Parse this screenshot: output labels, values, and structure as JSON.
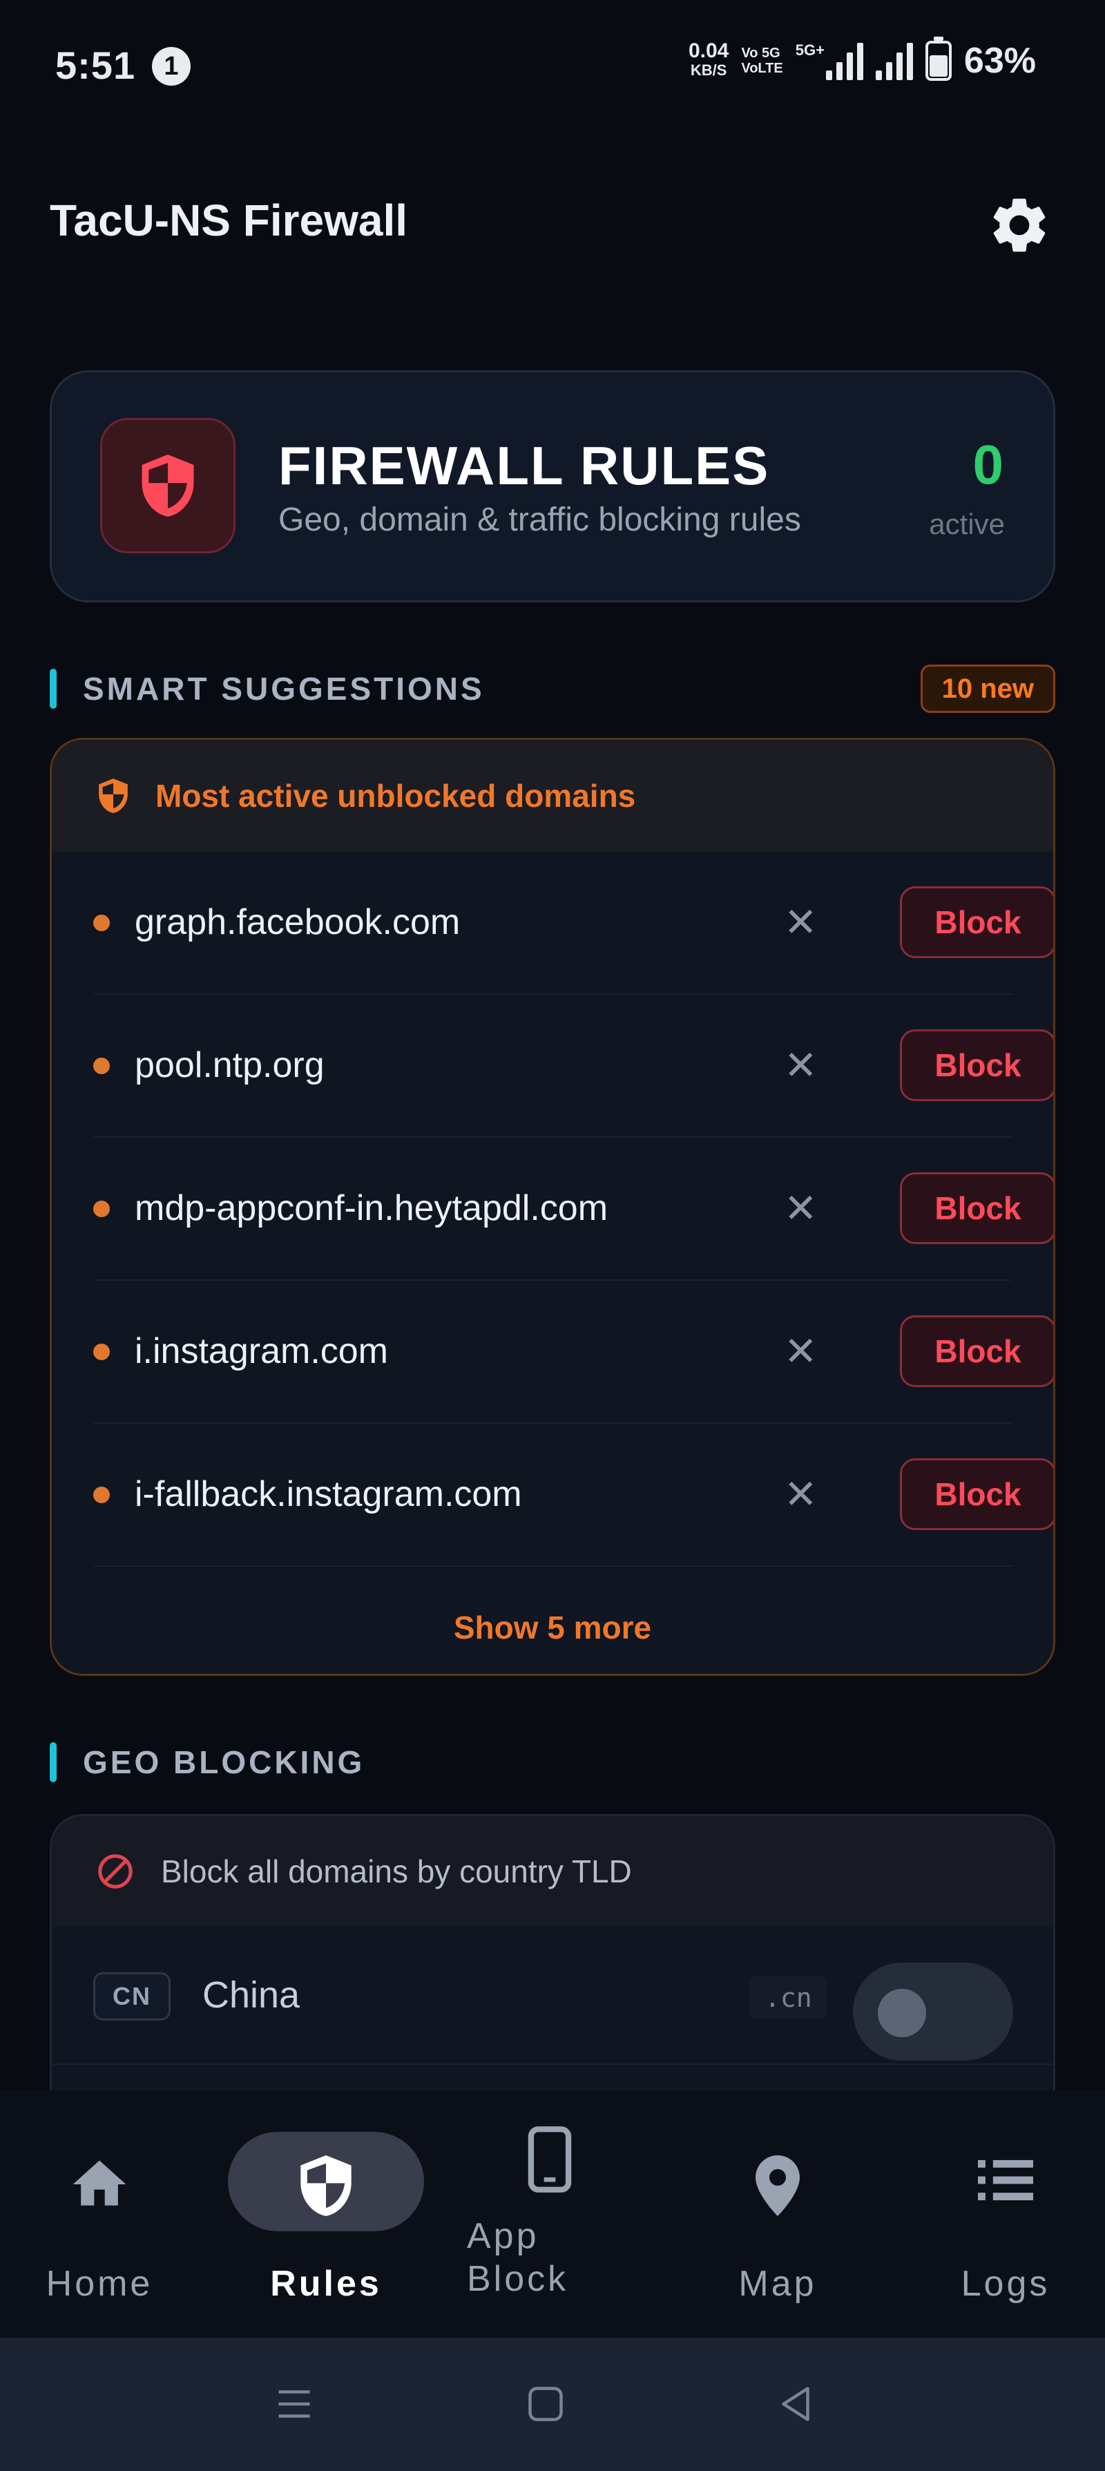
{
  "status_bar": {
    "time": "5:51",
    "notification_count": "1",
    "net_speed": "0.04",
    "net_unit": "KB/S",
    "volte_top": "Vo 5G",
    "volte_bottom": "VoLTE",
    "network": "5G+",
    "battery": "63%"
  },
  "app_bar": {
    "title": "TacU-NS Firewall",
    "settings_icon": "gear-icon"
  },
  "hero": {
    "title": "FIREWALL RULES",
    "subtitle": "Geo, domain & traffic blocking rules",
    "count": "0",
    "count_label": "active",
    "icon": "shield-icon",
    "colors": {
      "accent_red": "#ff4a5a",
      "count_green": "#2fcb6c"
    }
  },
  "smart_suggestions": {
    "section_title": "SMART SUGGESTIONS",
    "badge": "10 new",
    "header_text": "Most active unblocked domains",
    "items": [
      {
        "domain": "graph.facebook.com",
        "dismiss": "✕",
        "action": "Block"
      },
      {
        "domain": "pool.ntp.org",
        "dismiss": "✕",
        "action": "Block"
      },
      {
        "domain": "mdp-appconf-in.heytapdl.com",
        "dismiss": "✕",
        "action": "Block"
      },
      {
        "domain": "i.instagram.com",
        "dismiss": "✕",
        "action": "Block"
      },
      {
        "domain": "i-fallback.instagram.com",
        "dismiss": "✕",
        "action": "Block"
      }
    ],
    "show_more": "Show 5 more",
    "colors": {
      "accent_orange": "#f0782a"
    }
  },
  "geo_blocking": {
    "section_title": "GEO BLOCKING",
    "header_text": "Block all domains by country TLD",
    "rows": [
      {
        "code": "CN",
        "country": "China",
        "tld": ".cn",
        "enabled": false
      }
    ]
  },
  "bottom_nav": {
    "items": [
      {
        "label": "Home",
        "icon": "home-icon",
        "active": false
      },
      {
        "label": "Rules",
        "icon": "shield-icon",
        "active": true
      },
      {
        "label": "App Block",
        "icon": "phone-icon",
        "active": false
      },
      {
        "label": "Map",
        "icon": "map-pin-icon",
        "active": false
      },
      {
        "label": "Logs",
        "icon": "list-icon",
        "active": false
      }
    ]
  },
  "system_nav": {
    "icons": [
      "menu-icon",
      "home-square-icon",
      "back-icon"
    ]
  }
}
